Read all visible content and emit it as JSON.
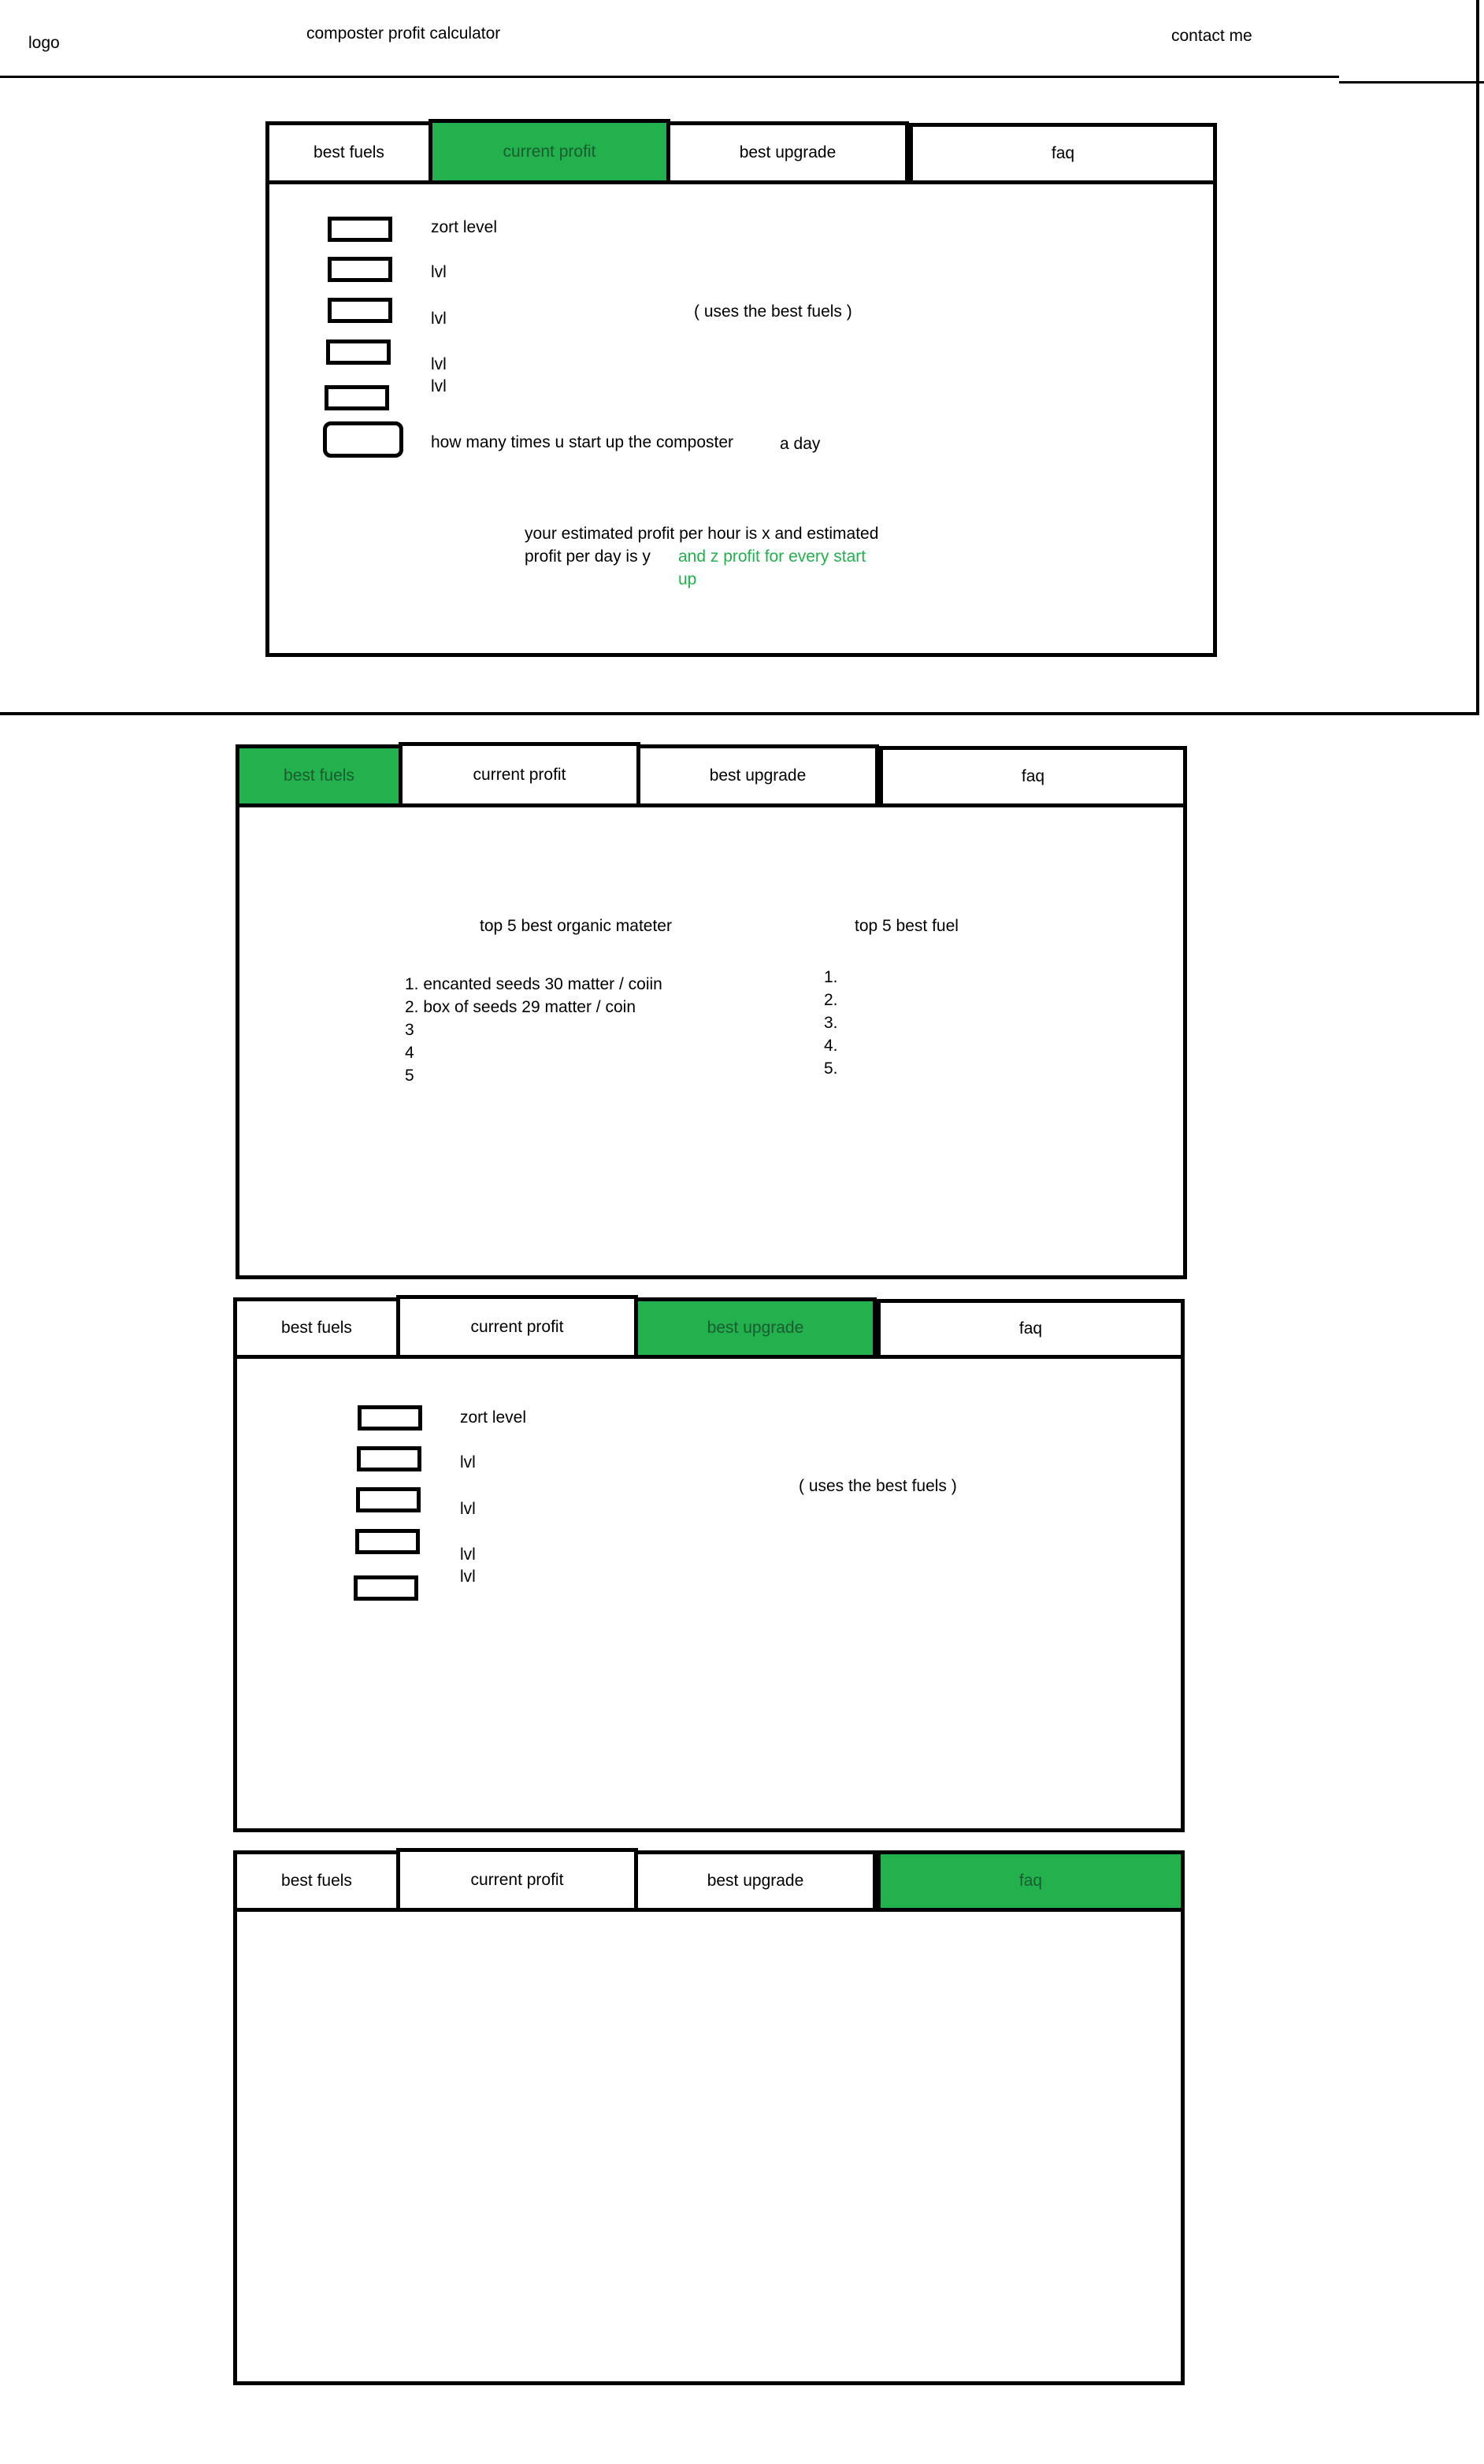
{
  "colors": {
    "accent": "#22b14c",
    "border": "#000000",
    "background": "#ffffff"
  },
  "header": {
    "logo": "logo",
    "title": "composter profit calculator",
    "contact": "contact me"
  },
  "tabs": [
    "best fuels",
    "current profit",
    "best upgrade",
    "faq"
  ],
  "current_profit_view": {
    "active_tab": "current profit",
    "field_labels": [
      "zort level",
      "lvl",
      "lvl",
      "lvl",
      "lvl"
    ],
    "note": "( uses the best fuels )",
    "startups_label": "how many times u start up the composter",
    "startups_suffix": "a day",
    "result_line1": "your estimated profit per hour is x and estimated",
    "result_line2": "profit per day is y",
    "result_green": "and z profit for every start",
    "result_green2": "up"
  },
  "best_fuels_view": {
    "active_tab": "best fuels",
    "organic_title": "top 5 best organic mateter",
    "organic_items": [
      "1. encanted seeds 30 matter / coiin",
      "2. box of seeds 29 matter / coin",
      "3",
      "4",
      "5"
    ],
    "fuel_title": "top 5 best fuel",
    "fuel_items": [
      "1.",
      "2.",
      "3.",
      "4.",
      "5."
    ]
  },
  "best_upgrade_view": {
    "active_tab": "best upgrade",
    "field_labels": [
      "zort level",
      "lvl",
      "lvl",
      "lvl",
      "lvl"
    ],
    "note": "( uses the best fuels )"
  },
  "faq_view": {
    "active_tab": "faq"
  }
}
